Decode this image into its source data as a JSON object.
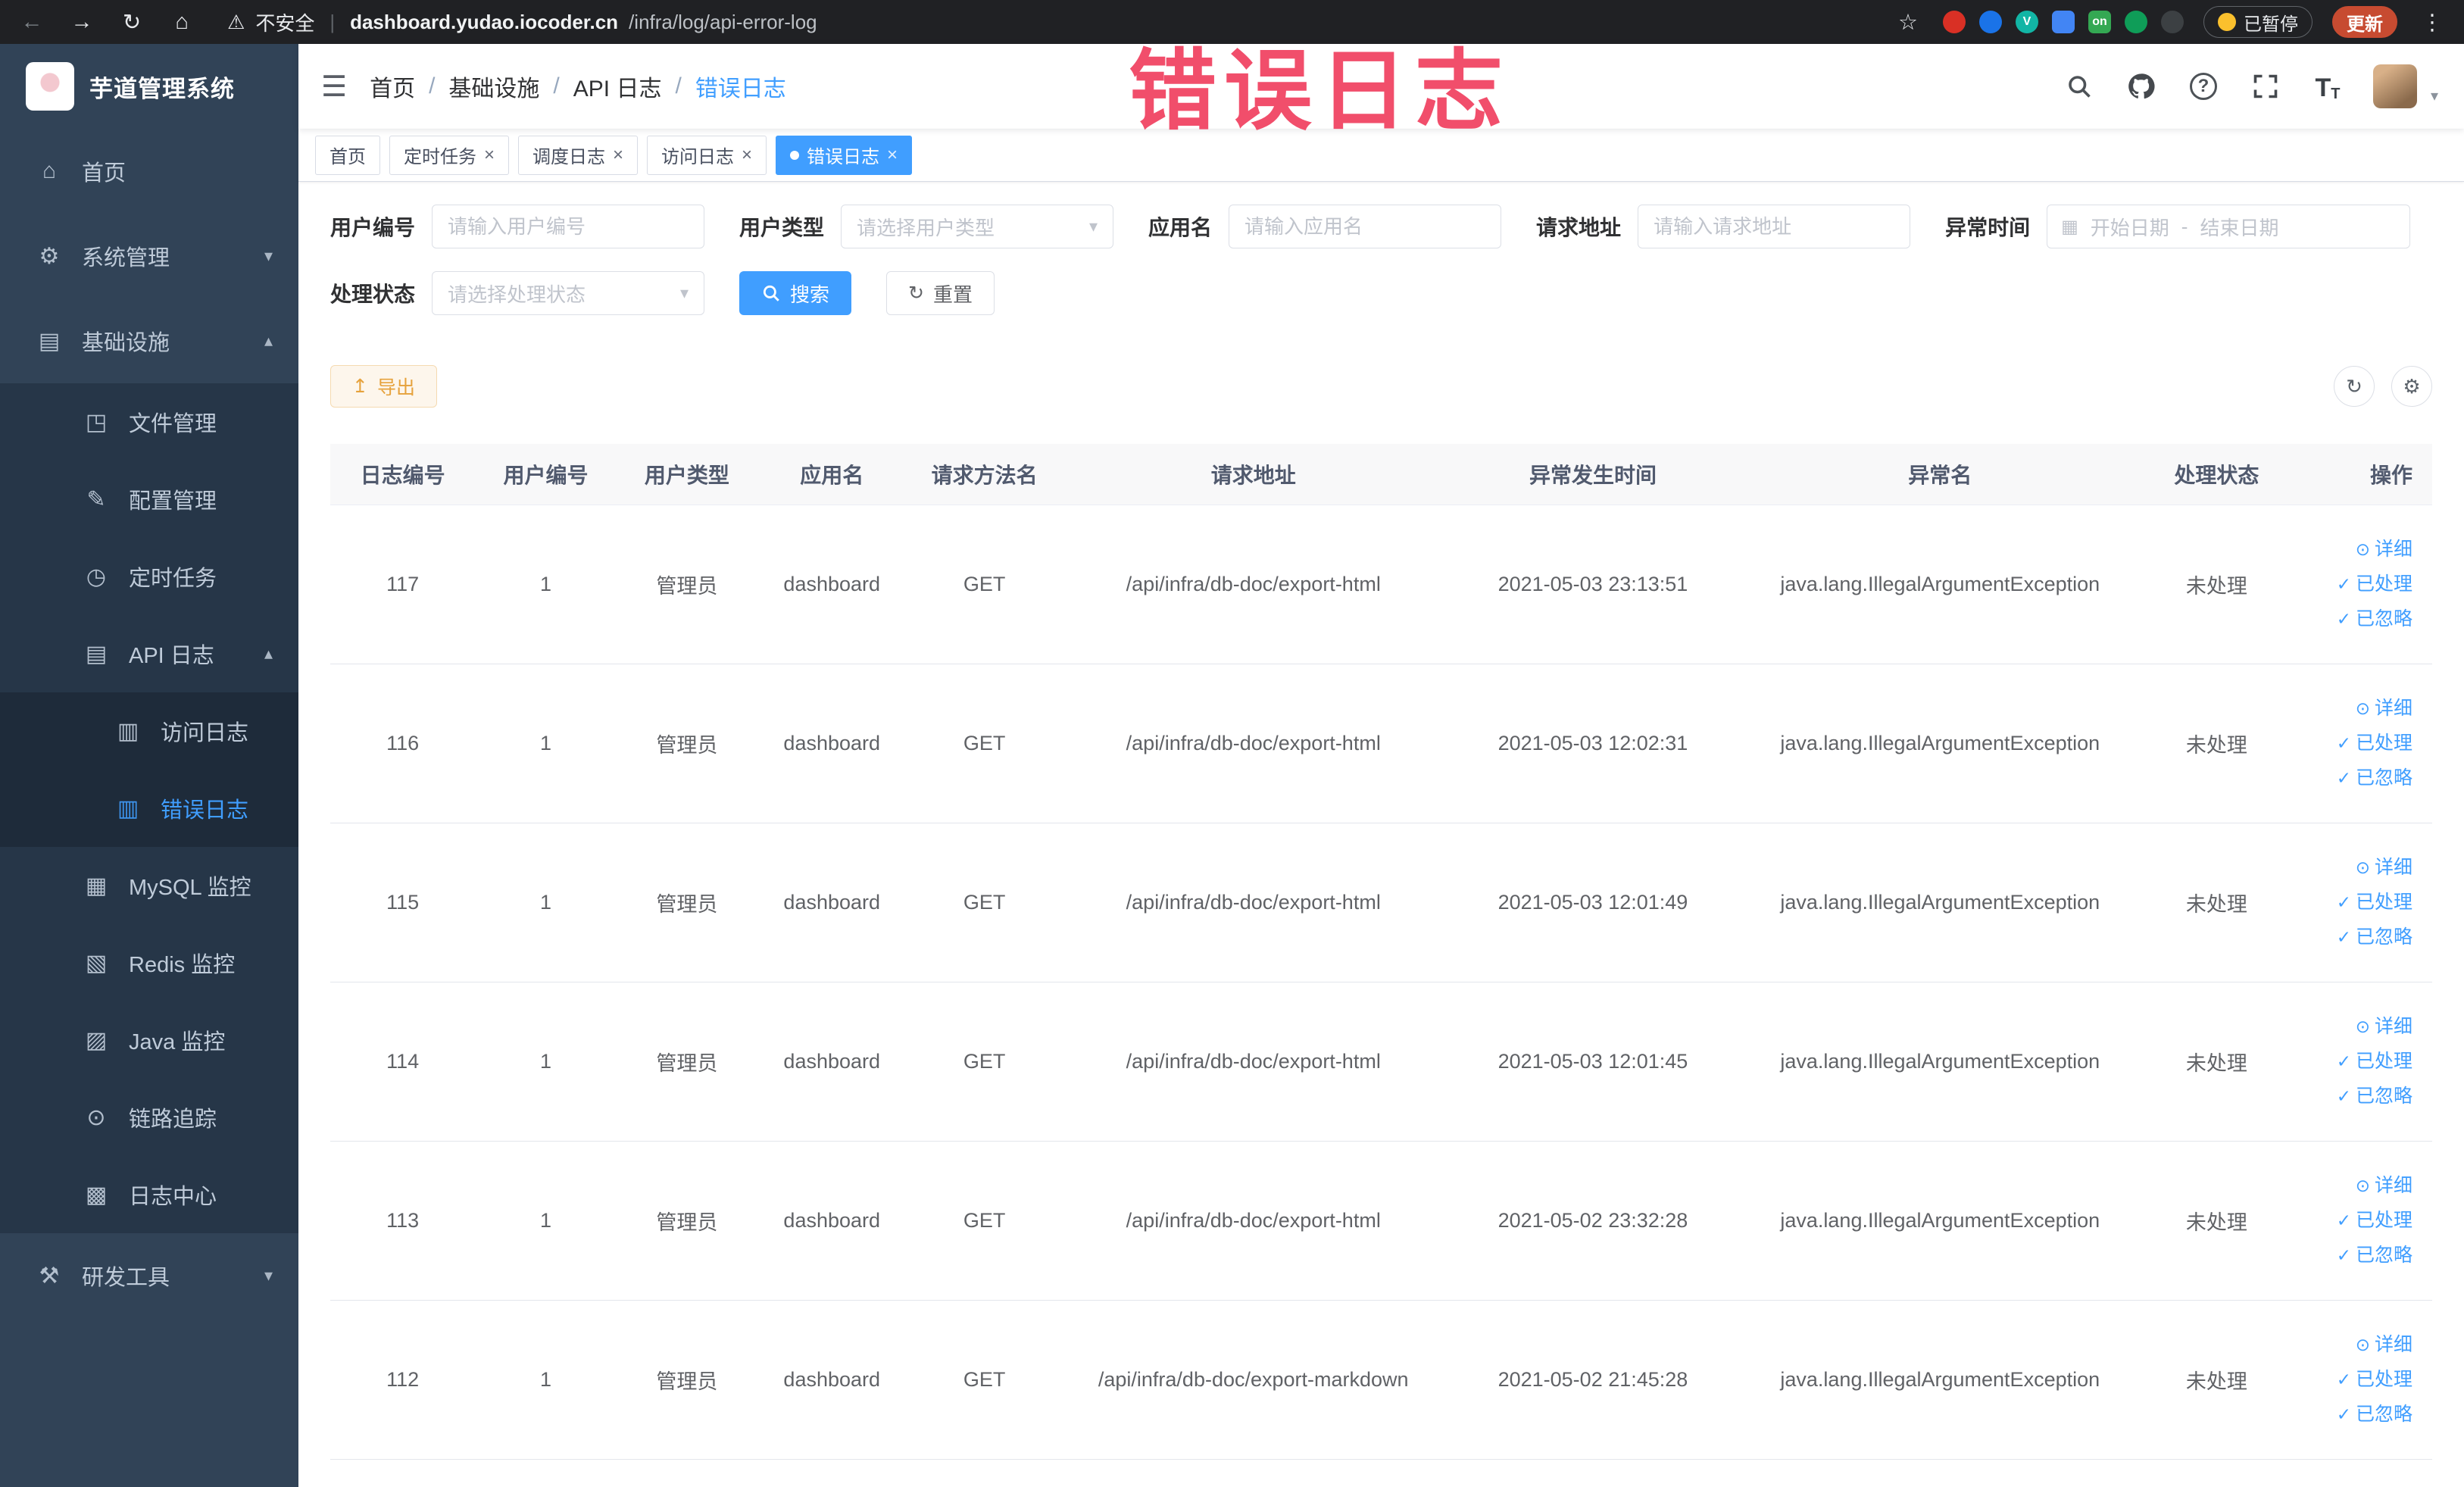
{
  "watermark": "错误日志",
  "icons": {
    "back": "←",
    "forward": "→",
    "reload": "↻",
    "home": "⌂",
    "warning": "⚠",
    "star": "☆",
    "overflow": "⋮",
    "hamburger": "☰",
    "crumb_sep": "/",
    "question": "?",
    "font_large": "T",
    "font_small": "T",
    "avatar_caret": "▾",
    "select_caret": "▾",
    "calendar": "▦",
    "reset": "↻",
    "export": "↥",
    "refresh": "↻",
    "settings": "⚙",
    "close": "×"
  },
  "browser": {
    "security_label": "不安全",
    "security_sep": "|",
    "url_domain": "dashboard.yudao.iocoder.cn",
    "url_path": "/infra/log/api-error-log",
    "paused_label": "已暂停",
    "update_label": "更新",
    "extensions": [
      {
        "name": "extension-icon-red",
        "style": "background:#d93025"
      },
      {
        "name": "extension-icon-blue",
        "style": "background:#1a73e8"
      },
      {
        "name": "extension-icon-teal",
        "style": "background:#12b5a5",
        "label": "V"
      },
      {
        "name": "extension-icon-grid",
        "style": "background:#4285f4; border-radius:7px"
      },
      {
        "name": "extension-icon-on",
        "style": "background:#34a853; border-radius:7px",
        "label": "on"
      },
      {
        "name": "extension-icon-leaf",
        "style": "background:#0f9d58"
      },
      {
        "name": "extension-icon-paw",
        "style": "background:#3c4043"
      }
    ]
  },
  "sidebar": {
    "logo_title": "芋道管理系统",
    "items": [
      {
        "name": "sidebar-item-home",
        "icon": "home-icon",
        "icon_glyph": "⌂",
        "label": "首页",
        "level": 1
      },
      {
        "name": "sidebar-item-system",
        "icon": "gear-icon",
        "icon_glyph": "⚙",
        "label": "系统管理",
        "level": 1,
        "arrow": "▾"
      },
      {
        "name": "sidebar-item-infra",
        "icon": "infra-icon",
        "icon_glyph": "▤",
        "label": "基础设施",
        "level": 1,
        "arrow": "▴"
      },
      {
        "name": "sidebar-item-file",
        "icon": "folder-icon",
        "icon_glyph": "◳",
        "label": "文件管理",
        "level": 2
      },
      {
        "name": "sidebar-item-config",
        "icon": "edit-icon",
        "icon_glyph": "✎",
        "label": "配置管理",
        "level": 2
      },
      {
        "name": "sidebar-item-job",
        "icon": "clock-icon",
        "icon_glyph": "◷",
        "label": "定时任务",
        "level": 2
      },
      {
        "name": "sidebar-item-api-log",
        "icon": "log-icon",
        "icon_glyph": "▤",
        "label": "API 日志",
        "level": 2,
        "arrow": "▴"
      },
      {
        "name": "sidebar-item-access-log",
        "icon": "document-icon",
        "icon_glyph": "▥",
        "label": "访问日志",
        "level": 3
      },
      {
        "name": "sidebar-item-error-log",
        "icon": "document-icon",
        "icon_glyph": "▥",
        "label": "错误日志",
        "level": 3,
        "active": true
      },
      {
        "name": "sidebar-item-mysql",
        "icon": "database-icon",
        "icon_glyph": "▦",
        "label": "MySQL 监控",
        "level": 2
      },
      {
        "name": "sidebar-item-redis",
        "icon": "redis-icon",
        "icon_glyph": "▧",
        "label": "Redis 监控",
        "level": 2
      },
      {
        "name": "sidebar-item-java",
        "icon": "java-icon",
        "icon_glyph": "▨",
        "label": "Java 监控",
        "level": 2
      },
      {
        "name": "sidebar-item-trace",
        "icon": "eye-icon",
        "icon_glyph": "⊙",
        "label": "链路追踪",
        "level": 2
      },
      {
        "name": "sidebar-item-log-center",
        "icon": "log-center-icon",
        "icon_glyph": "▩",
        "label": "日志中心",
        "level": 2
      },
      {
        "name": "sidebar-item-devtools",
        "icon": "tools-icon",
        "icon_glyph": "⚒",
        "label": "研发工具",
        "level": 1,
        "arrow": "▾"
      }
    ]
  },
  "header": {
    "breadcrumb": [
      {
        "name": "breadcrumb-home",
        "label": "首页"
      },
      {
        "name": "breadcrumb-infra",
        "label": "基础设施",
        "sep": true
      },
      {
        "name": "breadcrumb-api-log",
        "label": "API 日志",
        "sep": true
      },
      {
        "name": "breadcrumb-error-log",
        "label": "错误日志",
        "sep": true,
        "current": true
      }
    ]
  },
  "tabs": [
    {
      "name": "tab-home",
      "label": "首页"
    },
    {
      "name": "tab-job",
      "label": "定时任务",
      "closable": true
    },
    {
      "name": "tab-job-log",
      "label": "调度日志",
      "closable": true
    },
    {
      "name": "tab-access-log",
      "label": "访问日志",
      "closable": true
    },
    {
      "name": "tab-error-log",
      "label": "错误日志",
      "closable": true,
      "active": true
    }
  ],
  "filters": {
    "user_id": {
      "label": "用户编号",
      "placeholder": "请输入用户编号"
    },
    "user_type": {
      "label": "用户类型",
      "placeholder": "请选择用户类型"
    },
    "app_name": {
      "label": "应用名",
      "placeholder": "请输入应用名"
    },
    "request_url": {
      "label": "请求地址",
      "placeholder": "请输入请求地址"
    },
    "exception_time": {
      "label": "异常时间",
      "start_placeholder": "开始日期",
      "separator": "-",
      "end_placeholder": "结束日期"
    },
    "process_status": {
      "label": "处理状态",
      "placeholder": "请选择处理状态"
    },
    "search_label": "搜索",
    "reset_label": "重置"
  },
  "toolbar": {
    "export_label": "导出"
  },
  "table": {
    "columns": [
      "日志编号",
      "用户编号",
      "用户类型",
      "应用名",
      "请求方法名",
      "请求地址",
      "异常发生时间",
      "异常名",
      "处理状态",
      "操作"
    ],
    "actions": {
      "detail": "详细",
      "processed": "已处理",
      "ignored": "已忽略"
    },
    "action_icons": {
      "detail": "⊙",
      "processed": "✓",
      "ignored": "✓"
    },
    "rows": [
      {
        "log_id": "117",
        "user_id": "1",
        "user_type": "管理员",
        "app_name": "dashboard",
        "method": "GET",
        "url": "/api/infra/db-doc/export-html",
        "time": "2021-05-03 23:13:51",
        "exception": "java.lang.IllegalArgumentException",
        "status": "未处理"
      },
      {
        "log_id": "116",
        "user_id": "1",
        "user_type": "管理员",
        "app_name": "dashboard",
        "method": "GET",
        "url": "/api/infra/db-doc/export-html",
        "time": "2021-05-03 12:02:31",
        "exception": "java.lang.IllegalArgumentException",
        "status": "未处理"
      },
      {
        "log_id": "115",
        "user_id": "1",
        "user_type": "管理员",
        "app_name": "dashboard",
        "method": "GET",
        "url": "/api/infra/db-doc/export-html",
        "time": "2021-05-03 12:01:49",
        "exception": "java.lang.IllegalArgumentException",
        "status": "未处理"
      },
      {
        "log_id": "114",
        "user_id": "1",
        "user_type": "管理员",
        "app_name": "dashboard",
        "method": "GET",
        "url": "/api/infra/db-doc/export-html",
        "time": "2021-05-03 12:01:45",
        "exception": "java.lang.IllegalArgumentException",
        "status": "未处理"
      },
      {
        "log_id": "113",
        "user_id": "1",
        "user_type": "管理员",
        "app_name": "dashboard",
        "method": "GET",
        "url": "/api/infra/db-doc/export-html",
        "time": "2021-05-02 23:32:28",
        "exception": "java.lang.IllegalArgumentException",
        "status": "未处理"
      },
      {
        "log_id": "112",
        "user_id": "1",
        "user_type": "管理员",
        "app_name": "dashboard",
        "method": "GET",
        "url": "/api/infra/db-doc/export-markdown",
        "time": "2021-05-02 21:45:28",
        "exception": "java.lang.IllegalArgumentException",
        "status": "未处理"
      }
    ]
  }
}
